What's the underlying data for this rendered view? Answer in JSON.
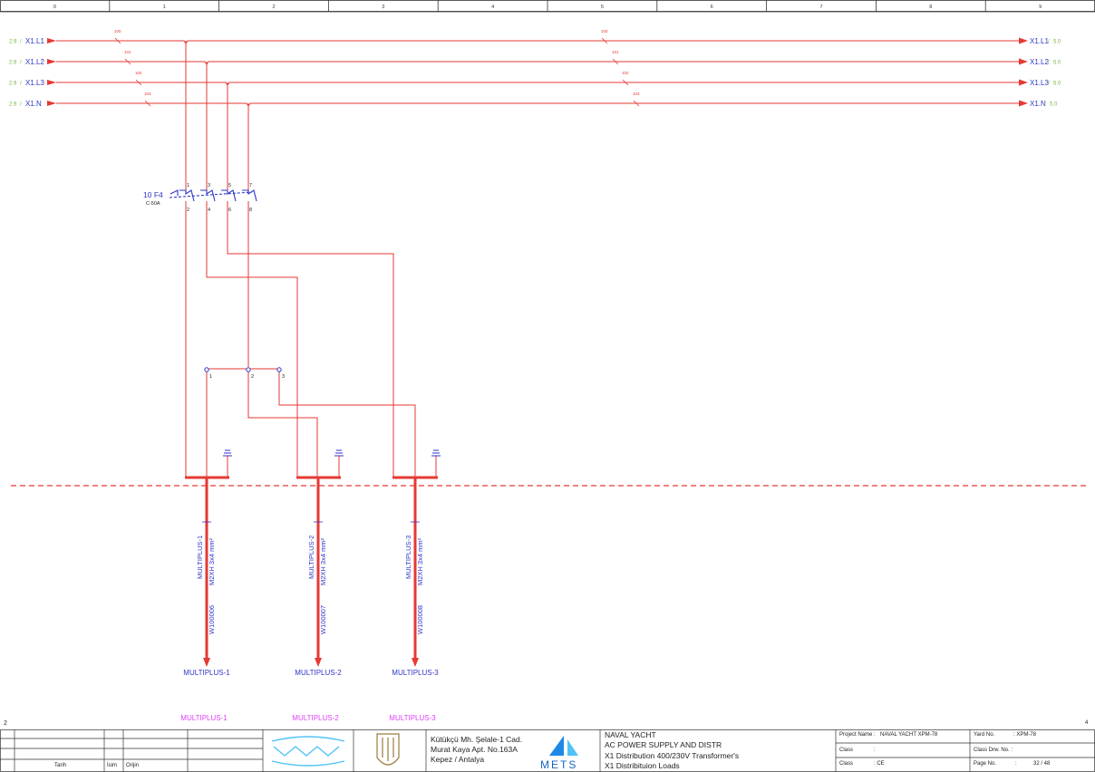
{
  "columns": [
    "0",
    "1",
    "2",
    "3",
    "4",
    "5",
    "6",
    "7",
    "8",
    "9"
  ],
  "colors": {
    "wire": "#e53935",
    "label_blue": "#2e36c8",
    "ref_green": "#7cb342",
    "magenta": "#e040fb",
    "dashed": "#e53935"
  },
  "buses": [
    {
      "left_ref": "2.9",
      "label": "X1.L1",
      "right_ref": "5.0",
      "wire_left": "100",
      "wire_right": "100"
    },
    {
      "left_ref": "2.9",
      "label": "X1.L2",
      "right_ref": "5.0",
      "wire_left": "101",
      "wire_right": "101"
    },
    {
      "left_ref": "2.9",
      "label": "X1.L3",
      "right_ref": "5.0",
      "wire_left": "102",
      "wire_right": "102"
    },
    {
      "left_ref": "2.9",
      "label": "X1.N",
      "right_ref": "5.0",
      "wire_left": "103",
      "wire_right": "103"
    }
  ],
  "breaker": {
    "tag": "10 F4",
    "rating": "C-50A",
    "top_terminals": [
      "1",
      "3",
      "5",
      "7"
    ],
    "bottom_terminals": [
      "2",
      "4",
      "6",
      "8"
    ]
  },
  "switch_terminals": [
    "1",
    "2",
    "3"
  ],
  "cables": [
    {
      "name": "MULTIPLUS-1",
      "spec": "M2XH 3x4 mm²",
      "id": "W100006",
      "dest": "MULTIPLUS-1",
      "footer": "MULTIPLUS-1"
    },
    {
      "name": "MULTIPLUS-2",
      "spec": "M2XH 3x4 mm²",
      "id": "W100007",
      "dest": "MULTIPLUS-2",
      "footer": "MULTIPLUS-2"
    },
    {
      "name": "MULTIPLUS-3",
      "spec": "M2XH 3x4 mm²",
      "id": "W100008",
      "dest": "MULTIPLUS-3",
      "footer": "MULTIPLUS-3"
    }
  ],
  "page_left_num": "2",
  "page_right_num": "4",
  "title_block": {
    "rev_headers": {
      "date": "Tarih",
      "name": "İsim",
      "orig": "Orijin"
    },
    "address": [
      "Kütükçü Mh. Şelale-1 Cad.",
      "Murat Kaya Apt. No.163A",
      "Kepez  / Antalya"
    ],
    "logo_mets": "METS",
    "titles": [
      "NAVAL YACHT",
      "AC POWER SUPPLY AND DISTR",
      "X1 Distribution 400/230V Transformer's",
      "X1 Distribituion Loads"
    ],
    "project_label": "Project Name :",
    "project_value": "NAVAL YACHT  XPM-78",
    "class1_label": "Class",
    "class1_value": ":",
    "class2_label": "Class",
    "class2_value": ": CE",
    "yard_label": "Yard No.",
    "yard_value": ": XPM-78",
    "classdrw_label": "Class Drw. No. :",
    "page_label": "Page No.",
    "page_sep": ":",
    "page_value": "32 / 48"
  }
}
